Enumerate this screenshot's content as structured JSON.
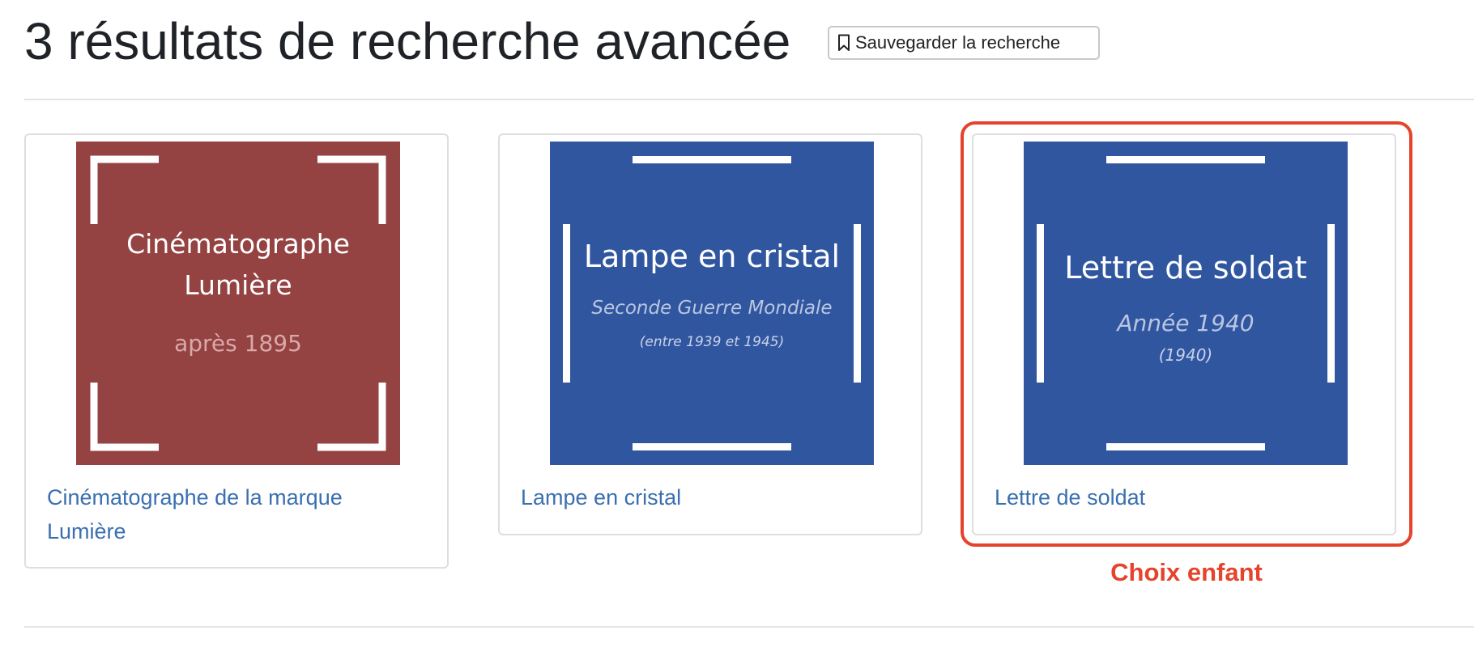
{
  "header": {
    "title": "3 résultats de recherche avancée",
    "save_button_label": "Sauvegarder la recherche"
  },
  "results": [
    {
      "link_text": "Cinématographe de la marque Lumière",
      "thumbnail": {
        "line1": "Cinématographe",
        "line2": "Lumière",
        "line3": "après 1895",
        "background": "#944242",
        "frame_style": "corner-brackets"
      }
    },
    {
      "link_text": "Lampe en cristal",
      "thumbnail": {
        "line1": "Lampe en cristal",
        "line2": "Seconde Guerre Mondiale",
        "line3": "(entre 1939 et 1945)",
        "background": "#3156a0",
        "frame_style": "edge-bars"
      }
    },
    {
      "link_text": "Lettre de soldat",
      "thumbnail": {
        "line1": "Lettre de soldat",
        "line2": "Année 1940",
        "line3": "(1940)",
        "background": "#3156a0",
        "frame_style": "edge-bars"
      }
    }
  ],
  "annotation": {
    "label": "Choix enfant",
    "color": "#e5432b"
  },
  "colors": {
    "link": "#3a6fb0",
    "card_border": "#dedede",
    "thumb_red": "#944242",
    "thumb_blue": "#3156a0"
  }
}
